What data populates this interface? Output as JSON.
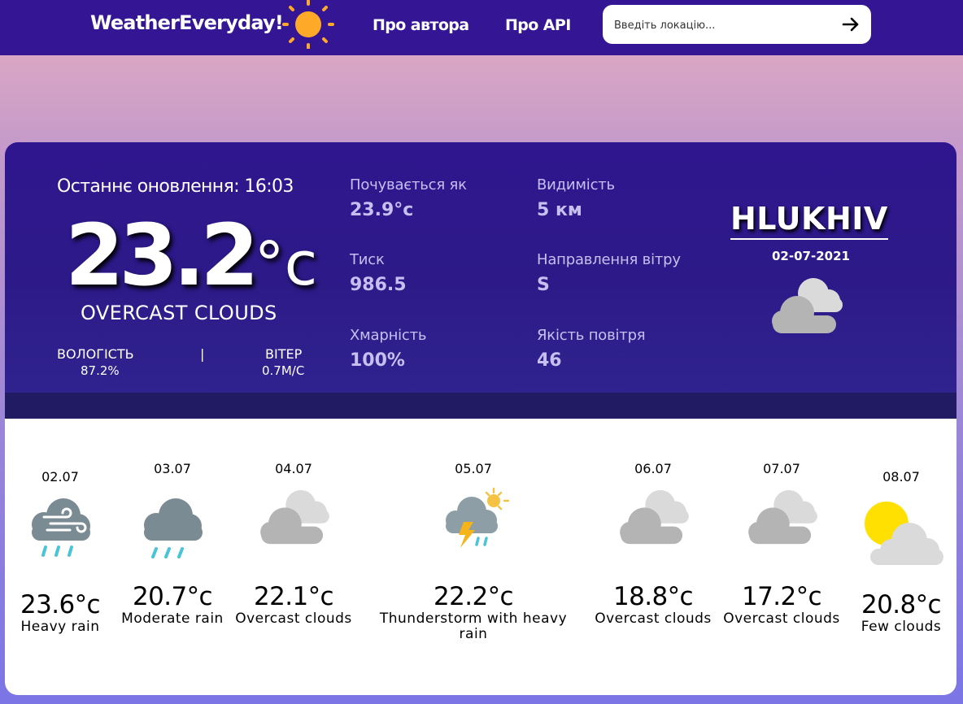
{
  "header": {
    "logo": "WeatherEveryday!",
    "nav": [
      "Про автора",
      "Про API"
    ],
    "search_placeholder": "Введіть локацію...",
    "icons": {
      "logo": "sun-icon",
      "search_submit": "arrow-right-icon"
    }
  },
  "current": {
    "updated": "Останнє оновлення: 16:03",
    "temp": "23.2",
    "unit": "°c",
    "condition": "OVERCAST CLOUDS",
    "humidity_label": "ВОЛОГІСТЬ",
    "humidity": "87.2%",
    "divider": "|",
    "wind_label": "ВІТЕР",
    "wind": "0.7М/С",
    "stats": [
      {
        "label": "Почувається як",
        "value": "23.9°c"
      },
      {
        "label": "Видимість",
        "value": "5 км"
      },
      {
        "label": "Тиск",
        "value": "986.5"
      },
      {
        "label": "Направлення вітру",
        "value": "S"
      },
      {
        "label": "Хмарність",
        "value": "100%"
      },
      {
        "label": "Якість повітря",
        "value": "46"
      }
    ],
    "city": "HLUKHIV",
    "date": "02-07-2021",
    "icon": "overcast-clouds-icon"
  },
  "forecast": [
    {
      "date": "02.07",
      "temp": "23.6°c",
      "desc": "Heavy rain",
      "icon": "heavy-rain-icon"
    },
    {
      "date": "03.07",
      "temp": "20.7°c",
      "desc": "Moderate rain",
      "icon": "moderate-rain-icon"
    },
    {
      "date": "04.07",
      "temp": "22.1°c",
      "desc": "Overcast clouds",
      "icon": "overcast-clouds-icon"
    },
    {
      "date": "05.07",
      "temp": "22.2°c",
      "desc": "Thunderstorm with heavy rain",
      "icon": "thunderstorm-icon"
    },
    {
      "date": "06.07",
      "temp": "18.8°c",
      "desc": "Overcast clouds",
      "icon": "overcast-clouds-icon"
    },
    {
      "date": "07.07",
      "temp": "17.2°c",
      "desc": "Overcast clouds",
      "icon": "overcast-clouds-icon"
    },
    {
      "date": "08.07",
      "temp": "20.8°c",
      "desc": "Few clouds",
      "icon": "few-clouds-icon"
    }
  ],
  "colors": {
    "topbar": "#341694",
    "panel": "#2f168f",
    "sun": "#ffa928",
    "rain": "#4cc4d8",
    "cloud_dark": "#7b8b93",
    "cloud_grey": "#b4b4b4",
    "lightning": "#f6b41a"
  }
}
